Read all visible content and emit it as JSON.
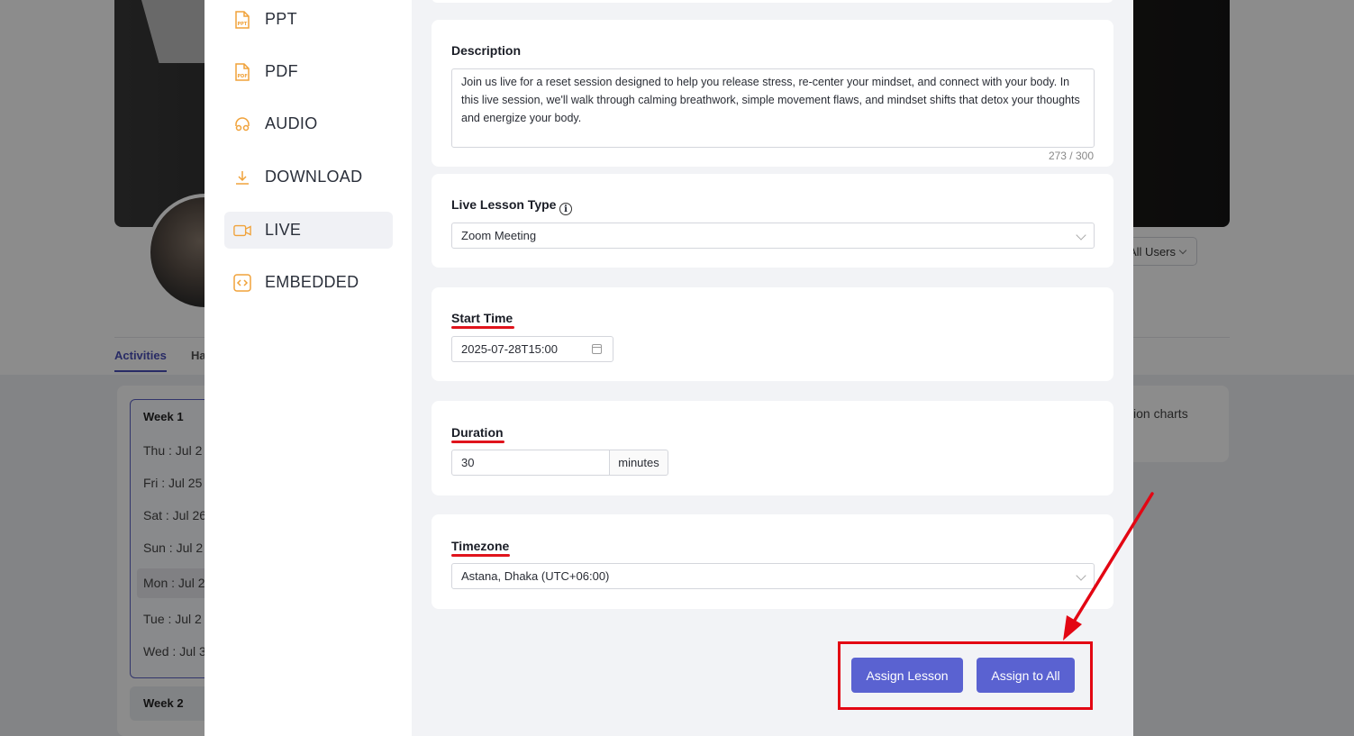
{
  "background": {
    "filter_label": "All Users",
    "tabs": [
      "Activities",
      "Ha"
    ],
    "week1_title": "Week 1",
    "days": [
      "Thu : Jul 2",
      "Fri : Jul 25",
      "Sat : Jul 26",
      "Sun : Jul 2",
      "Mon : Jul 2",
      "Tue : Jul 2",
      "Wed : Jul 3"
    ],
    "week2_title": "Week 2",
    "right_text": "ion charts"
  },
  "sidebar": {
    "items": [
      {
        "label": "PPT",
        "icon": "ppt-file-icon"
      },
      {
        "label": "PDF",
        "icon": "pdf-file-icon"
      },
      {
        "label": "AUDIO",
        "icon": "audio-icon"
      },
      {
        "label": "DOWNLOAD",
        "icon": "download-icon"
      },
      {
        "label": "LIVE",
        "icon": "video-camera-icon",
        "active": true
      },
      {
        "label": "EMBEDDED",
        "icon": "embed-code-icon"
      }
    ]
  },
  "form": {
    "description": {
      "label": "Description",
      "value": "Join us live for a reset session designed to help you release stress, re-center your mindset, and connect with your body. In this live session, we'll walk through calming breathwork, simple movement flaws, and mindset shifts that detox your thoughts and energize your body.",
      "counter": "273 / 300"
    },
    "lesson_type": {
      "label": "Live Lesson Type",
      "value": "Zoom Meeting"
    },
    "start_time": {
      "label": "Start Time",
      "value": "2025-07-28T15:00"
    },
    "duration": {
      "label": "Duration",
      "value": "30",
      "unit": "minutes"
    },
    "timezone": {
      "label": "Timezone",
      "value": "Astana, Dhaka (UTC+06:00)"
    }
  },
  "actions": {
    "assign_lesson": "Assign Lesson",
    "assign_all": "Assign to All"
  },
  "colors": {
    "accent": "#5a62d1",
    "annotation": "#e30613",
    "icon_orange": "#f0a23a"
  }
}
